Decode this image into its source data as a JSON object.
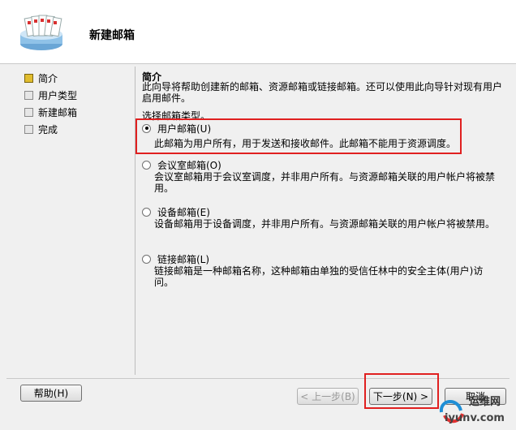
{
  "header": {
    "title": "新建邮箱"
  },
  "nav": {
    "items": [
      {
        "label": "简介",
        "active": true
      },
      {
        "label": "用户类型",
        "active": false
      },
      {
        "label": "新建邮箱",
        "active": false
      },
      {
        "label": "完成",
        "active": false
      }
    ]
  },
  "content": {
    "section_title": "简介",
    "description": "此向导将帮助创建新的邮箱、资源邮箱或链接邮箱。还可以使用此向导针对现有用户启用邮件。",
    "choose_label": "选择邮箱类型。",
    "options": [
      {
        "label": "用户邮箱(U)",
        "description": "此邮箱为用户所有，用于发送和接收邮件。此邮箱不能用于资源调度。",
        "checked": true
      },
      {
        "label": "会议室邮箱(O)",
        "description": "会议室邮箱用于会议室调度，并非用户所有。与资源邮箱关联的用户帐户将被禁用。",
        "checked": false
      },
      {
        "label": "设备邮箱(E)",
        "description": "设备邮箱用于设备调度，并非用户所有。与资源邮箱关联的用户帐户将被禁用。",
        "checked": false
      },
      {
        "label": "链接邮箱(L)",
        "description": "链接邮箱是一种邮箱名称，这种邮箱由单独的受信任林中的安全主体(用户)访问。",
        "checked": false
      }
    ]
  },
  "buttons": {
    "help": "帮助(H)",
    "back": "< 上一步(B)",
    "next": "下一步(N) >",
    "cancel": "取消"
  },
  "watermark": {
    "text_cn": "运维网",
    "text_url": "iyunv.com"
  },
  "colors": {
    "highlight": "#e02020",
    "active_nav": "#e1bd2e"
  }
}
